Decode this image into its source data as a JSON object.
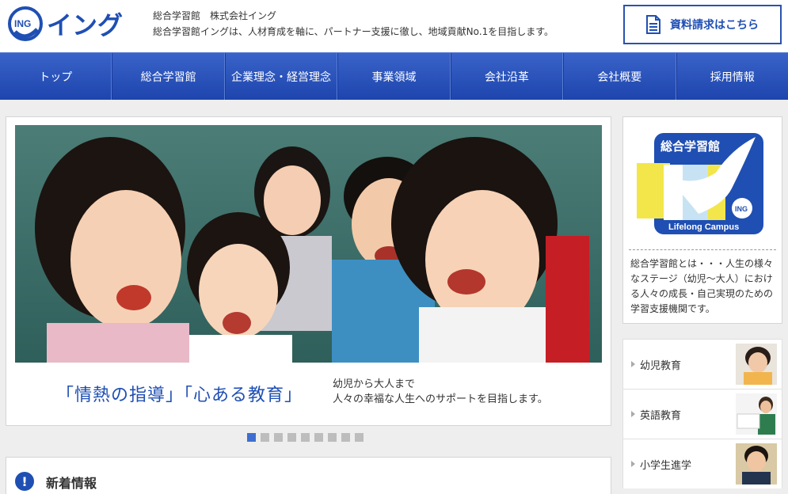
{
  "header": {
    "logo_text": "ING",
    "brand_name": "イング",
    "tagline_1": "総合学習館　株式会社イング",
    "tagline_2": "総合学習館イングは、人材育成を軸に、パートナー支援に徹し、地域貢献No.1を目指します。",
    "request_button": "資料請求はこちら"
  },
  "nav": {
    "items": [
      "トップ",
      "総合学習館",
      "企業理念・経営理念",
      "事業領域",
      "会社沿革",
      "会社概要",
      "採用情報"
    ]
  },
  "slider": {
    "catch_copy": "「情熱の指導」「心ある教育」",
    "sub_line_1": "幼児から大人まで",
    "sub_line_2": "人々の幸福な人生へのサポートを目指します。",
    "slide_count": 9,
    "active_index": 0
  },
  "news": {
    "icon": "exclamation-icon",
    "title": "新着情報"
  },
  "side": {
    "logo_title": "総合学習館",
    "logo_badge": "ING",
    "logo_caption": "Lifelong Campus",
    "description": "総合学習館とは・・・人生の様々なステージ（幼児〜大人）における人々の成長・自己実現のための学習支援機関です。",
    "menu": [
      {
        "label": "幼児教育"
      },
      {
        "label": "英語教育"
      },
      {
        "label": "小学生進学"
      }
    ]
  },
  "colors": {
    "brand_blue": "#1f4fb3",
    "nav_top": "#3a63c9",
    "nav_bottom": "#1d45ad",
    "accent_yellow": "#f2e64a"
  }
}
